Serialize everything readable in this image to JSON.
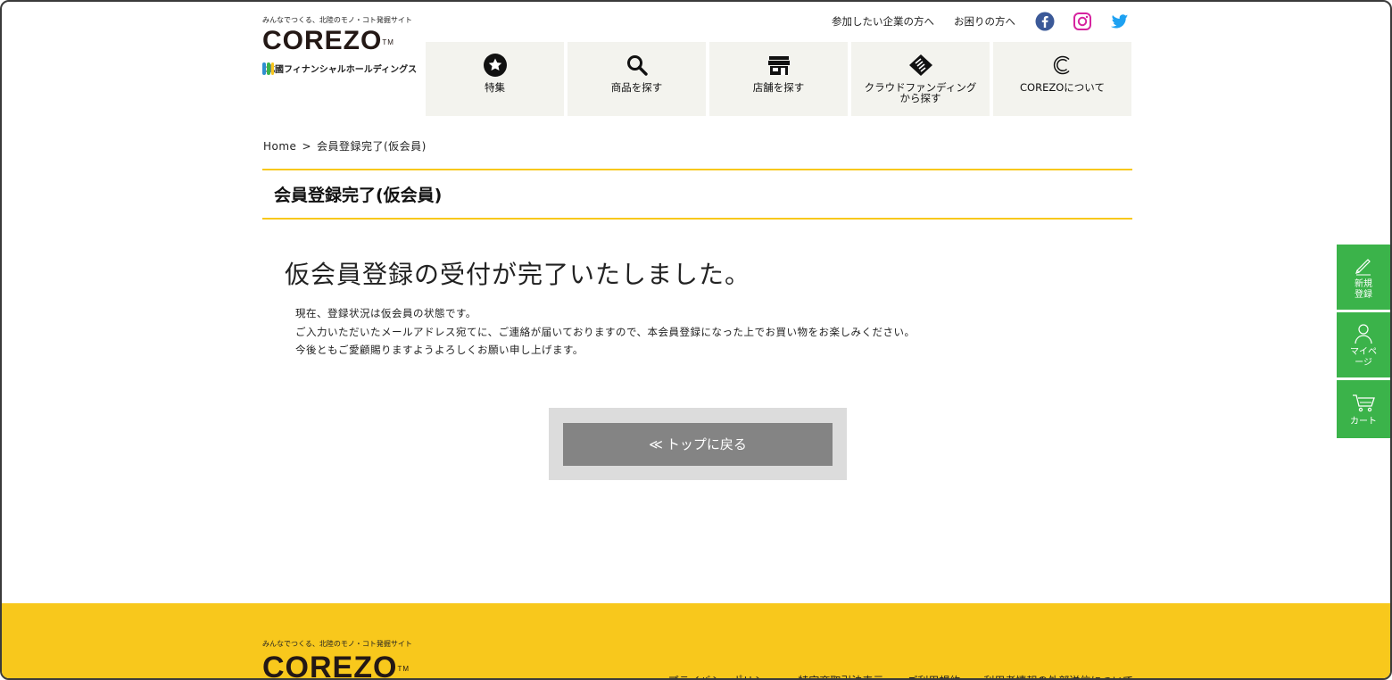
{
  "header": {
    "logo": {
      "tagline": "みんなでつくる、北陸のモノ・コト発掘サイト",
      "wordmark": "COREZO",
      "trademark": "TM",
      "holding_name": "北國フィナンシャルホールディングス"
    },
    "util_links": [
      {
        "label": "参加したい企業の方へ"
      },
      {
        "label": "お困りの方へ"
      }
    ],
    "sns": [
      {
        "icon": "facebook-icon",
        "color": "#3b5998"
      },
      {
        "icon": "instagram-icon",
        "color": "#d6249f"
      },
      {
        "icon": "twitter-icon",
        "color": "#1da1f2"
      }
    ],
    "nav": [
      {
        "label": "特集",
        "icon": "star-icon"
      },
      {
        "label": "商品を探す",
        "icon": "search-icon"
      },
      {
        "label": "店舗を探す",
        "icon": "store-icon"
      },
      {
        "label": "クラウドファンディング\nから探す",
        "label_line1": "クラウドファンディング",
        "label_line2": "から探す",
        "icon": "handshake-icon"
      },
      {
        "label": "COREZOについて",
        "icon": "corezo-c-icon"
      }
    ]
  },
  "breadcrumb": {
    "home": "Home",
    "separator": ">",
    "current": "会員登録完了(仮会員)"
  },
  "page_title": "会員登録完了(仮会員)",
  "main": {
    "heading": "仮会員登録の受付が完了いたしました。",
    "messages": [
      "現在、登録状況は仮会員の状態です。",
      "ご入力いただいたメールアドレス宛てに、ご連絡が届いておりますので、本会員登録になった上でお買い物をお楽しみください。",
      "今後ともご愛顧賜りますようよろしくお願い申し上げます。"
    ],
    "back_button": {
      "arrow": "≪",
      "label": "トップに戻る"
    }
  },
  "side_tabs": [
    {
      "label_line1": "新規",
      "label_line2": "登録",
      "icon": "pencil-icon"
    },
    {
      "label_line1": "マイペ",
      "label_line2": "ージ",
      "icon": "user-icon"
    },
    {
      "label_line1": "カート",
      "label_line2": "",
      "icon": "cart-icon"
    }
  ],
  "footer": {
    "tagline": "みんなでつくる、北陸のモノ・コト発掘サイト",
    "wordmark": "COREZO",
    "trademark": "TM",
    "links": [
      {
        "label": "プライバシーポリシー"
      },
      {
        "label": "特定商取引法表示"
      },
      {
        "label": "ご利用規約"
      },
      {
        "label": "利用者情報の外部送信について"
      }
    ]
  },
  "colors": {
    "accent_yellow": "#f8c81c",
    "nav_bg": "#f3f3ee",
    "side_green": "#3bb34a",
    "button_gray": "#848484",
    "button_frame": "#dcdcdc"
  }
}
